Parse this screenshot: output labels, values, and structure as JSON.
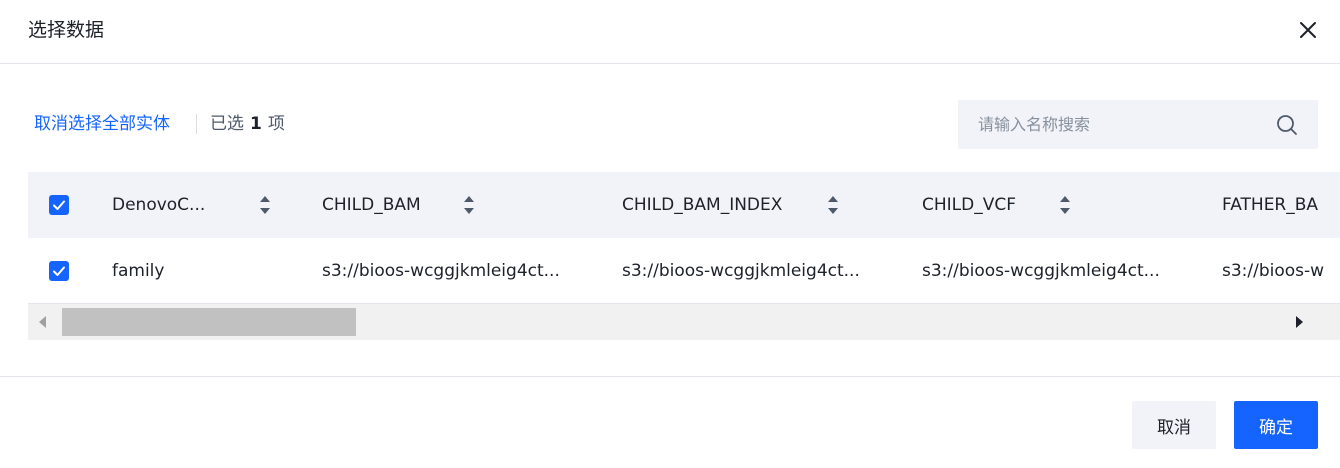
{
  "modal": {
    "title": "选择数据",
    "close_icon": "close-icon"
  },
  "toolbar": {
    "deselect_all_label": "取消选择全部实体",
    "selected_prefix": "已选",
    "selected_count": "1",
    "selected_suffix": "项"
  },
  "search": {
    "placeholder": "请输入名称搜索",
    "value": "",
    "icon": "search-icon"
  },
  "table": {
    "header_checked": true,
    "columns": [
      "DenovoC...",
      "CHILD_BAM",
      "CHILD_BAM_INDEX",
      "CHILD_VCF",
      "FATHER_BA"
    ],
    "rows": [
      {
        "checked": true,
        "cells": [
          "family",
          "s3://bioos-wcggjkmleig4ct...",
          "s3://bioos-wcggjkmleig4ct...",
          "s3://bioos-wcggjkmleig4ct...",
          "s3://bioos-w"
        ]
      }
    ]
  },
  "footer": {
    "cancel_label": "取消",
    "ok_label": "确定"
  },
  "colors": {
    "primary": "#1664ff",
    "header_bg": "#f2f3f8",
    "text": "#1d2129",
    "secondary_text": "#4e5969",
    "scroll_thumb": "#c1c1c1"
  }
}
